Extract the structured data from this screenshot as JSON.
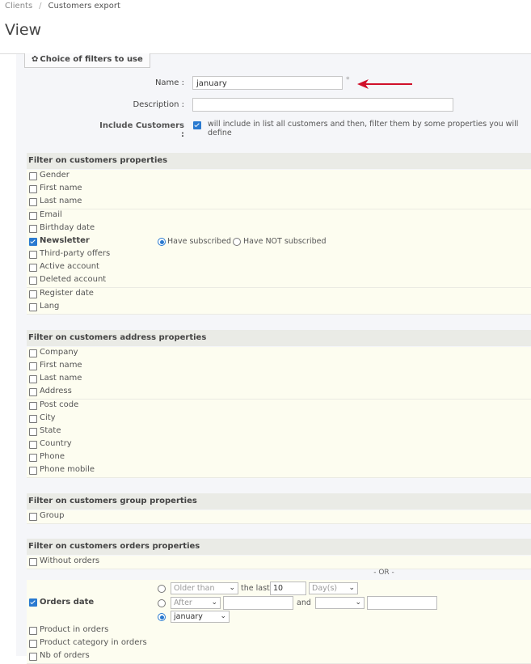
{
  "breadcrumb": {
    "parent": "Clients",
    "separator": "/",
    "current": "Customers export"
  },
  "page": {
    "title": "View"
  },
  "panel": {
    "legend": "Choice of filters to use",
    "gear_glyph": "✿"
  },
  "form": {
    "name_label": "Name :",
    "name_value": "january",
    "required_mark": "*",
    "description_label": "Description :",
    "description_value": "",
    "include_label": "Include Customers :",
    "include_checked": true,
    "include_note": "will include in list all customers and then, filter them by some properties you will define"
  },
  "sections": {
    "customer": {
      "header": "Filter on customers properties",
      "items": [
        "Gender",
        "First name",
        "Last name",
        "Email",
        "Birthday date",
        "Newsletter",
        "Third-party offers",
        "Active account",
        "Deleted account",
        "Register date",
        "Lang"
      ],
      "newsletter_options": [
        "Have subscribed",
        "Have NOT subscribed"
      ]
    },
    "address": {
      "header": "Filter on customers address properties",
      "items": [
        "Company",
        "First name",
        "Last name",
        "Address",
        "Post code",
        "City",
        "State",
        "Country",
        "Phone",
        "Phone mobile"
      ]
    },
    "group": {
      "header": "Filter on customers group properties",
      "items": [
        "Group"
      ]
    },
    "orders": {
      "header": "Filter on customers orders properties",
      "without_orders": "Without orders",
      "or_label": "- OR -",
      "orders_date_label": "Orders date",
      "older_than": "Older than",
      "the_last": "the last",
      "last_value": "10",
      "unit": "Day(s)",
      "after": "After",
      "and_label": "and",
      "month_value": "january",
      "product_in_orders": "Product in orders",
      "product_category_in_orders": "Product category in orders",
      "nb_of_orders": "Nb of orders"
    }
  },
  "colors": {
    "accent": "#2a7ad0",
    "arrow": "#d0102a"
  }
}
